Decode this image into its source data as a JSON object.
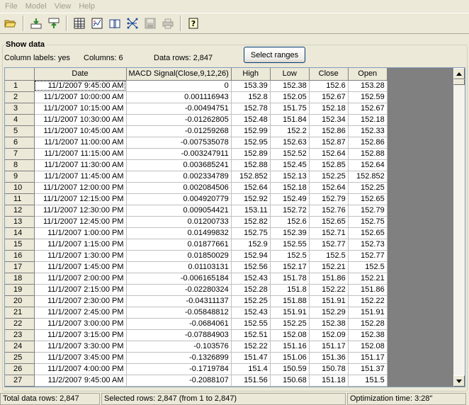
{
  "menu": [
    "File",
    "Model",
    "View",
    "Help"
  ],
  "toolbar": {
    "icons": [
      "open-folder-icon",
      "import-icon",
      "export-icon",
      "table-icon",
      "chart-icon",
      "book-icon",
      "network-icon",
      "save-icon",
      "print-icon",
      "help-icon"
    ]
  },
  "section": {
    "title": "Show data",
    "column_labels": "Column labels: yes",
    "columns": "Columns: 6",
    "data_rows": "Data rows: 2,847",
    "select_ranges_label": "Select ranges"
  },
  "grid": {
    "headers": [
      "Date",
      "MACD Signal(Close,9,12,26)",
      "High",
      "Low",
      "Close",
      "Open"
    ],
    "rows": [
      [
        "1",
        "11/1/2007 9:45:00 AM",
        "0",
        "153.39",
        "152.38",
        "152.6",
        "153.28"
      ],
      [
        "2",
        "11/1/2007 10:00:00 AM",
        "0.001116943",
        "152.8",
        "152.05",
        "152.67",
        "152.59"
      ],
      [
        "3",
        "11/1/2007 10:15:00 AM",
        "-0.00494751",
        "152.78",
        "151.75",
        "152.18",
        "152.67"
      ],
      [
        "4",
        "11/1/2007 10:30:00 AM",
        "-0.01262805",
        "152.48",
        "151.84",
        "152.34",
        "152.18"
      ],
      [
        "5",
        "11/1/2007 10:45:00 AM",
        "-0.01259268",
        "152.99",
        "152.2",
        "152.86",
        "152.33"
      ],
      [
        "6",
        "11/1/2007 11:00:00 AM",
        "-0.007535078",
        "152.95",
        "152.63",
        "152.87",
        "152.86"
      ],
      [
        "7",
        "11/1/2007 11:15:00 AM",
        "-0.003247911",
        "152.89",
        "152.52",
        "152.64",
        "152.88"
      ],
      [
        "8",
        "11/1/2007 11:30:00 AM",
        "0.003685241",
        "152.88",
        "152.45",
        "152.85",
        "152.64"
      ],
      [
        "9",
        "11/1/2007 11:45:00 AM",
        "0.002334789",
        "152.852",
        "152.13",
        "152.25",
        "152.852"
      ],
      [
        "10",
        "11/1/2007 12:00:00 PM",
        "0.002084506",
        "152.64",
        "152.18",
        "152.64",
        "152.25"
      ],
      [
        "11",
        "11/1/2007 12:15:00 PM",
        "0.004920779",
        "152.92",
        "152.49",
        "152.79",
        "152.65"
      ],
      [
        "12",
        "11/1/2007 12:30:00 PM",
        "0.009054421",
        "153.11",
        "152.72",
        "152.76",
        "152.79"
      ],
      [
        "13",
        "11/1/2007 12:45:00 PM",
        "0.01200733",
        "152.82",
        "152.6",
        "152.65",
        "152.75"
      ],
      [
        "14",
        "11/1/2007 1:00:00 PM",
        "0.01499832",
        "152.75",
        "152.39",
        "152.71",
        "152.65"
      ],
      [
        "15",
        "11/1/2007 1:15:00 PM",
        "0.01877661",
        "152.9",
        "152.55",
        "152.77",
        "152.73"
      ],
      [
        "16",
        "11/1/2007 1:30:00 PM",
        "0.01850029",
        "152.94",
        "152.5",
        "152.5",
        "152.77"
      ],
      [
        "17",
        "11/1/2007 1:45:00 PM",
        "0.01103131",
        "152.56",
        "152.17",
        "152.21",
        "152.5"
      ],
      [
        "18",
        "11/1/2007 2:00:00 PM",
        "-0.006165184",
        "152.43",
        "151.78",
        "151.86",
        "152.21"
      ],
      [
        "19",
        "11/1/2007 2:15:00 PM",
        "-0.02280324",
        "152.28",
        "151.8",
        "152.22",
        "151.86"
      ],
      [
        "20",
        "11/1/2007 2:30:00 PM",
        "-0.04311137",
        "152.25",
        "151.88",
        "151.91",
        "152.22"
      ],
      [
        "21",
        "11/1/2007 2:45:00 PM",
        "-0.05848812",
        "152.43",
        "151.91",
        "152.29",
        "151.91"
      ],
      [
        "22",
        "11/1/2007 3:00:00 PM",
        "-0.0684061",
        "152.55",
        "152.25",
        "152.38",
        "152.28"
      ],
      [
        "23",
        "11/1/2007 3:15:00 PM",
        "-0.07884903",
        "152.51",
        "152.08",
        "152.09",
        "152.38"
      ],
      [
        "24",
        "11/1/2007 3:30:00 PM",
        "-0.103576",
        "152.22",
        "151.16",
        "151.17",
        "152.08"
      ],
      [
        "25",
        "11/1/2007 3:45:00 PM",
        "-0.1326899",
        "151.47",
        "151.06",
        "151.36",
        "151.17"
      ],
      [
        "26",
        "11/1/2007 4:00:00 PM",
        "-0.1719784",
        "151.4",
        "150.59",
        "150.78",
        "151.37"
      ],
      [
        "27",
        "11/2/2007 9:45:00 AM",
        "-0.2088107",
        "151.56",
        "150.68",
        "151.18",
        "151.5"
      ]
    ]
  },
  "status": {
    "total": "Total data rows: 2,847",
    "selected": "Selected rows: 2,847  (from 1 to 2,847)",
    "optimization": "Optimization time: 3:28\""
  }
}
